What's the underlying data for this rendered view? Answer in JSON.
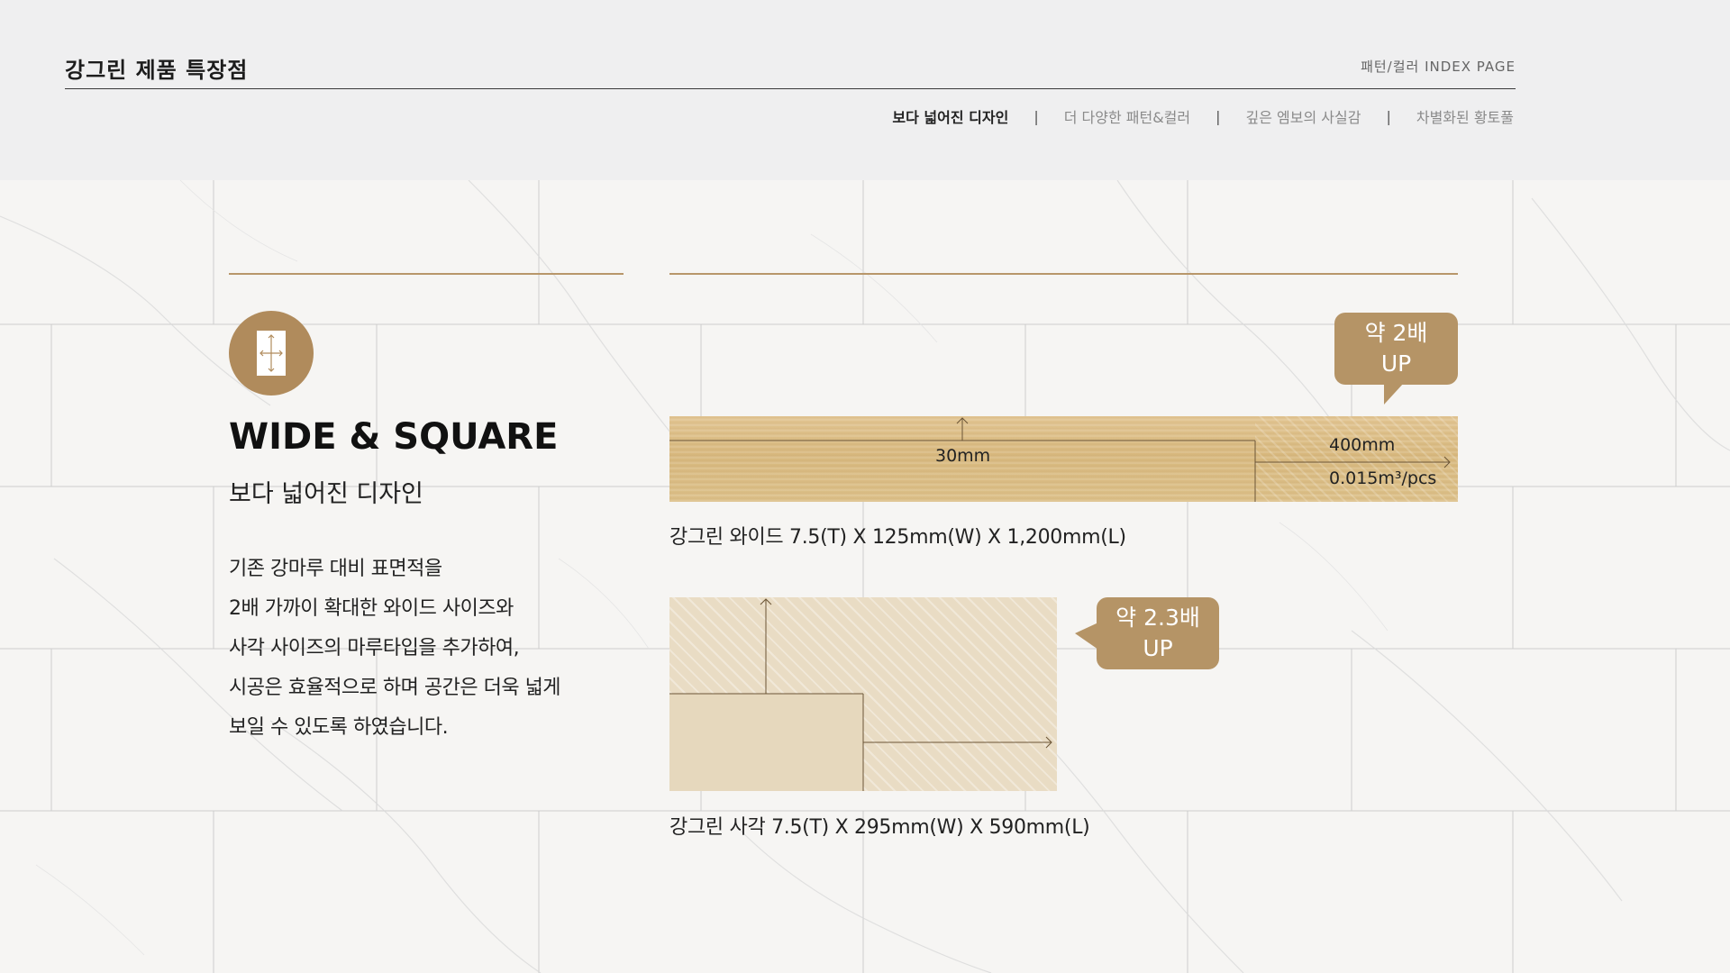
{
  "header": {
    "title": "강그린 제품 특장점",
    "index_link": "패턴/컬러 INDEX PAGE"
  },
  "subnav": {
    "items": [
      {
        "label": "보다 넓어진 디자인",
        "active": true
      },
      {
        "label": "더 다양한 패턴&컬러",
        "active": false
      },
      {
        "label": "깊은 엠보의 사실감",
        "active": false
      },
      {
        "label": "차별화된 황토풀",
        "active": false
      }
    ],
    "separator": "|"
  },
  "feature": {
    "icon": "resize-arrows-icon",
    "heading": "WIDE & SQUARE",
    "subheading": "보다 넓어진 디자인",
    "description": [
      "기존 강마루 대비 표면적을",
      "2배 가까이 확대한 와이드 사이즈와",
      "사각 사이즈의 마루타입을 추가하여,",
      "시공은 효율적으로 하며 공간은 더욱 넓게",
      "보일 수 있도록 하였습니다."
    ]
  },
  "wide_product": {
    "bubble_line1": "약 2배",
    "bubble_line2": "UP",
    "dim_center": "30mm",
    "dim_right_top": "400mm",
    "dim_right_bottom": "0.015m³/pcs",
    "caption": "강그린 와이드  7.5(T) X 125mm(W) X 1,200mm(L)"
  },
  "square_product": {
    "bubble_line1": "약 2.3배",
    "bubble_line2": "UP",
    "caption": "강그린 사각  7.5(T) X 295mm(W) X 590mm(L)"
  },
  "colors": {
    "gold": "#b08b5c",
    "bubble": "#b59466",
    "wood": "#dcbd86",
    "wood_light": "#e9dcc4"
  }
}
